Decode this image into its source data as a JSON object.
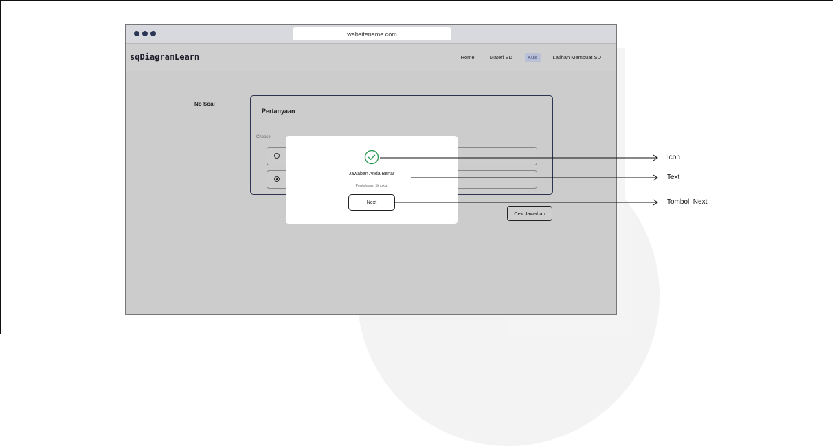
{
  "browser": {
    "url": "websitename.com"
  },
  "navbar": {
    "logo": "sqDiagramLearn",
    "links": [
      {
        "label": "Home",
        "active": false
      },
      {
        "label": "Materi SD",
        "active": false
      },
      {
        "label": "Kuis",
        "active": true
      },
      {
        "label": "Latihan Membuat SD",
        "active": false
      }
    ]
  },
  "quiz": {
    "no_soal_label": "No Soal",
    "question_title": "Pertanyaan",
    "choose_label": "Choose",
    "options": [
      {
        "checked": false
      },
      {
        "checked": true
      }
    ],
    "cek_button_label": "Cek Jawaban"
  },
  "modal": {
    "icon": "check-circle-icon",
    "title": "Jawaban Anda Benar",
    "explanation": "Penjelasan Singkat",
    "next_label": "Next"
  },
  "annotations": {
    "icon_label": "Icon",
    "text_label": "Text",
    "next_label": "Tombol  Next"
  },
  "colors": {
    "accent_green": "#2e9b55",
    "dot_navy": "#2b3556",
    "card_border": "#2e3352"
  }
}
